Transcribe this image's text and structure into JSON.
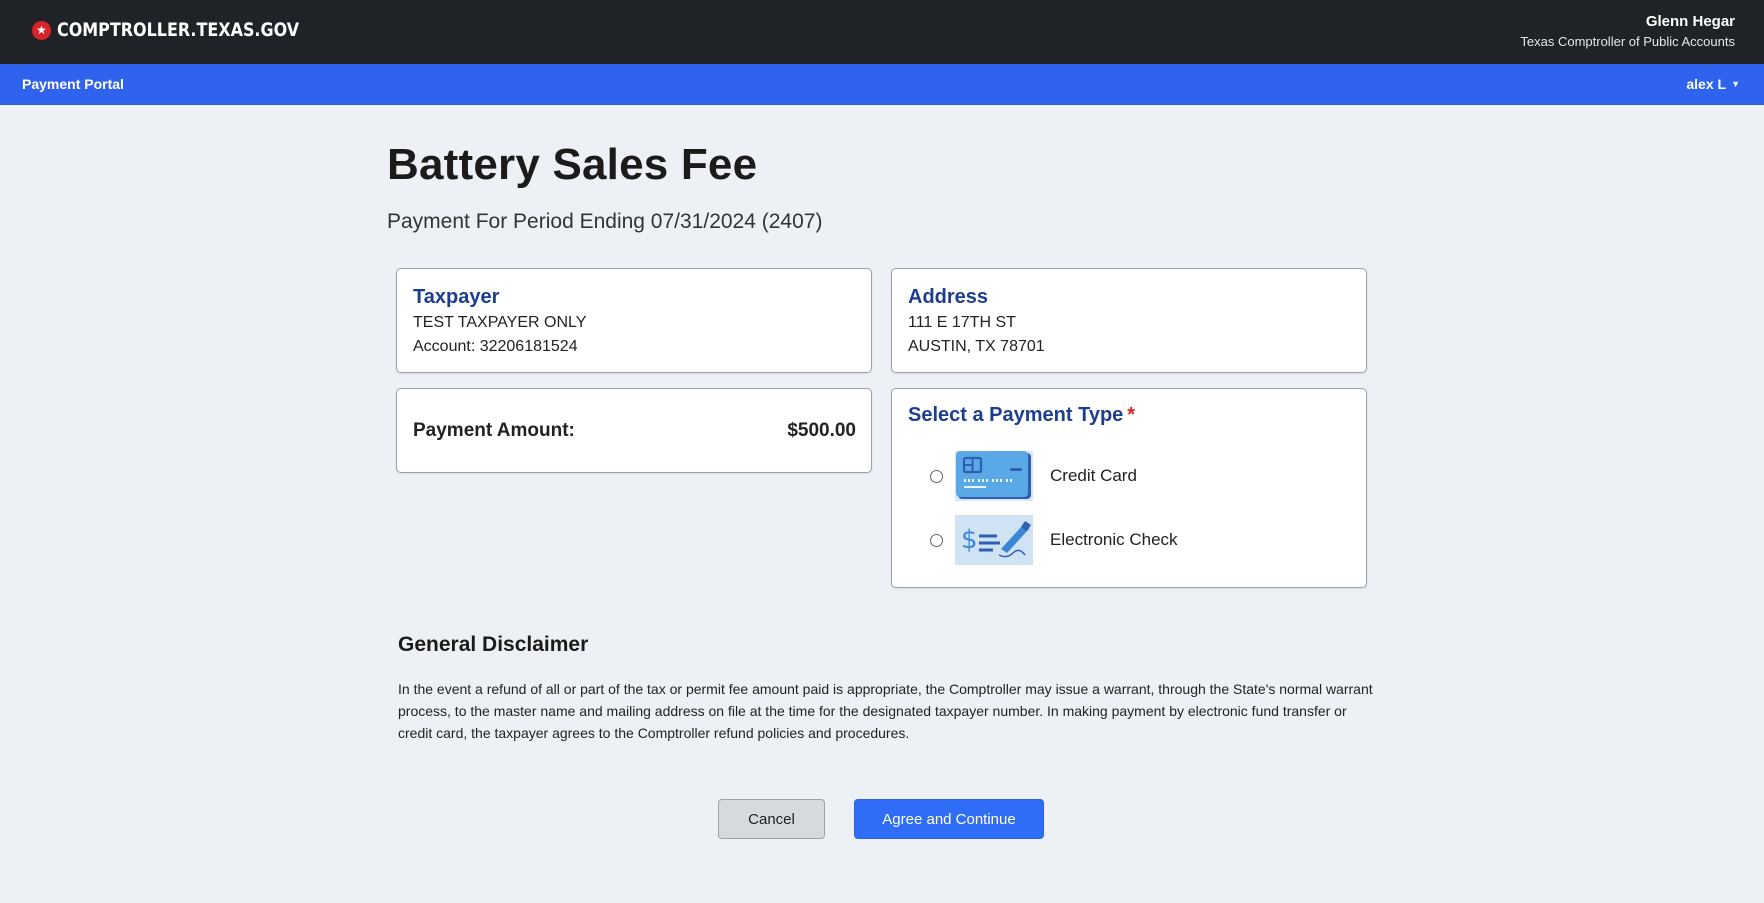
{
  "header": {
    "site_name": "COMPTROLLER.TEXAS.GOV",
    "official_name": "Glenn Hegar",
    "official_title": "Texas Comptroller of Public Accounts"
  },
  "nav": {
    "portal_label": "Payment Portal",
    "user_label": "alex L"
  },
  "page": {
    "title": "Battery Sales Fee",
    "period": "Payment For Period Ending 07/31/2024 (2407)"
  },
  "taxpayer": {
    "heading": "Taxpayer",
    "name": "TEST TAXPAYER ONLY",
    "account": "Account: 32206181524"
  },
  "address": {
    "heading": "Address",
    "line1": "111 E 17TH ST",
    "line2": "AUSTIN, TX 78701"
  },
  "payment_amount": {
    "label": "Payment Amount:",
    "value": "$500.00"
  },
  "payment_type": {
    "heading": "Select a Payment Type",
    "required_marker": "*",
    "options": [
      {
        "label": "Credit Card",
        "icon": "credit-card-icon",
        "selected": false
      },
      {
        "label": "Electronic Check",
        "icon": "electronic-check-icon",
        "selected": false
      }
    ]
  },
  "disclaimer": {
    "title": "General Disclaimer",
    "text": "In the event a refund of all or part of the tax or permit fee amount paid is appropriate, the Comptroller may issue a warrant, through the State's normal warrant process, to the master name and mailing address on file at the time for the designated taxpayer number. In making payment by electronic fund transfer or credit card, the taxpayer agrees to the Comptroller refund policies and procedures."
  },
  "actions": {
    "cancel_label": "Cancel",
    "agree_label": "Agree and Continue"
  },
  "colors": {
    "topbar": "#1f2327",
    "navbar": "#2f63ee",
    "heading_blue": "#1d3d8f",
    "primary_button": "#2f6df6",
    "required": "#d8232a"
  }
}
